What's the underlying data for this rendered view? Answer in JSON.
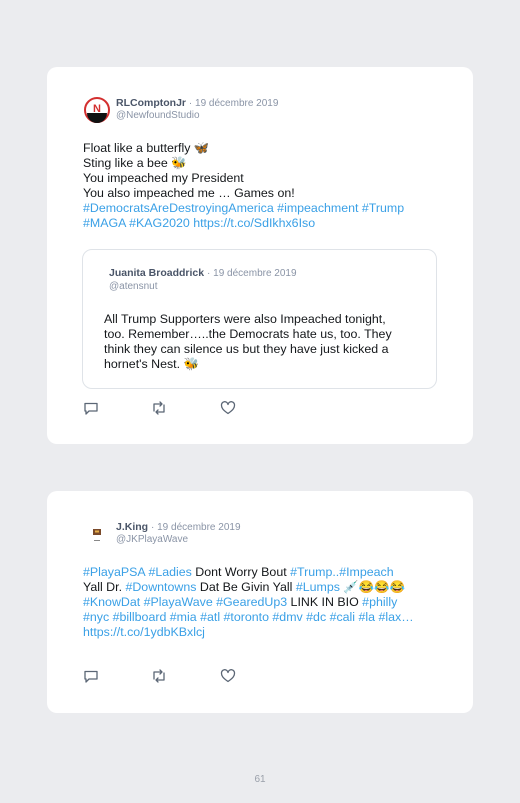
{
  "tweet1": {
    "author": "RLComptonJr",
    "date": "· 19 décembre 2019",
    "handle": "@NewfoundStudio",
    "lines": [
      "Float like a butterfly 🦋",
      "Sting like a bee 🐝",
      "You impeached my President",
      "You also impeached me … Games on!"
    ],
    "hashtags_line1": "#DemocratsAreDestroyingAmerica #impeachment #Trump",
    "hashtags_line2": "#MAGA #KAG2020 https://t.co/SdIkhx6Iso",
    "quote": {
      "author": "Juanita Broaddrick",
      "date": "· 19 décembre 2019",
      "handle": "@atensnut",
      "lines": [
        "All Trump Supporters were also Impeached tonight,",
        "too. Remember…..the Democrats hate us, too. They",
        "think they can silence us but they have just kicked a",
        "hornet's Nest. 🐝"
      ]
    }
  },
  "tweet2": {
    "author": "J.King",
    "date": "· 19 décembre 2019",
    "handle": "@JKPlayaWave",
    "l1_tag1": "#PlayaPSA",
    "l1_tag2": "#Ladies",
    "l1_text": " Dont Worry Bout ",
    "l1_tag3": "#Trump..#Impeach",
    "l2_text1": "Yall Dr. ",
    "l2_tag": "#Downtowns",
    "l2_text2": " Dat Be Givin Yall ",
    "l2_tag2": "#Lumps",
    "l2_emoji": " 💉😂😂😂",
    "l3_tags": "#KnowDat #PlayaWave #GearedUp3",
    "l3_text": " LINK IN BIO ",
    "l3_tag2": "#philly",
    "l4_tags": "#nyc #billboard #mia #atl #toronto #dmv #dc #cali #la #lax…",
    "l5_link": "https://t.co/1ydbKBxlcj"
  },
  "page_number": "61",
  "colors": {
    "accent": "#3aa0e6",
    "background": "#ebecef",
    "card": "#ffffff"
  },
  "icons": [
    "reply-icon",
    "retweet-icon",
    "like-icon"
  ]
}
